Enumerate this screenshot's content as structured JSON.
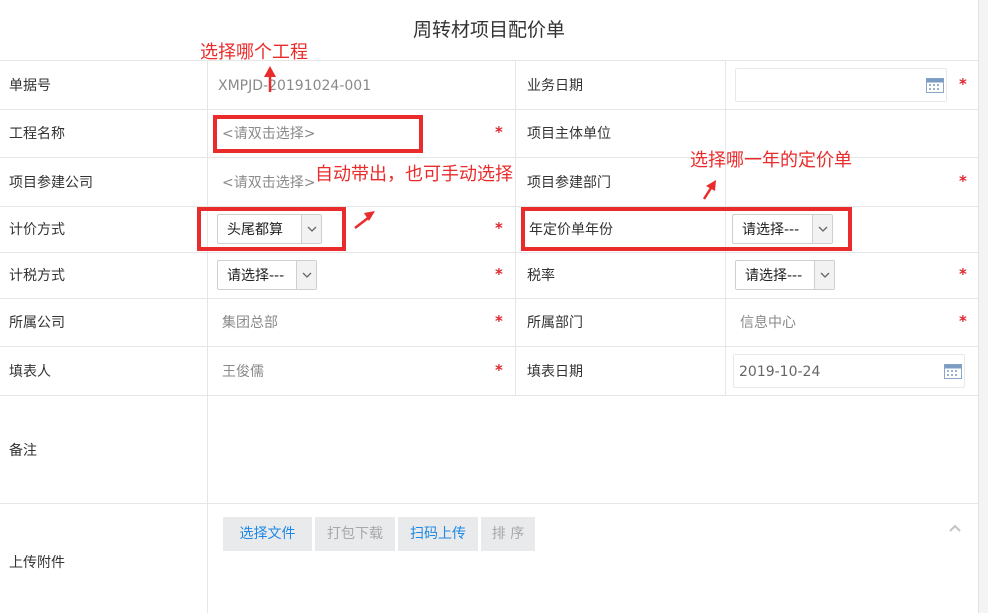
{
  "title": "周转材项目配价单",
  "fields": {
    "bill_no_label": "单据号",
    "bill_no_value": "XMPJD-20191024-001",
    "biz_date_label": "业务日期",
    "project_name_label": "工程名称",
    "project_name_value": "<请双击选择>",
    "project_unit_label": "项目主体单位",
    "project_company_label": "项目参建公司",
    "project_company_value": "<请双击选择>",
    "project_dept_label": "项目参建部门",
    "pricing_method_label": "计价方式",
    "pricing_method_value": "头尾都算",
    "year_label": "年定价单年份",
    "year_value": "请选择---",
    "tax_method_label": "计税方式",
    "tax_method_value": "请选择---",
    "tax_rate_label": "税率",
    "tax_rate_value": "请选择---",
    "company_label": "所属公司",
    "company_value": "集团总部",
    "dept_label": "所属部门",
    "dept_value": "信息中心",
    "filler_label": "填表人",
    "filler_value": "王俊儒",
    "fill_date_label": "填表日期",
    "fill_date_value": "2019-10-24",
    "remark_label": "备注",
    "attachment_label": "上传附件"
  },
  "required_mark": "*",
  "upload_buttons": {
    "select_file": "选择文件",
    "pack_download": "打包下载",
    "scan_upload": "扫码上传",
    "sort": "排 序"
  },
  "annotations": {
    "project_hint": "选择哪个工程",
    "auto_hint": "自动带出，也可手动选择",
    "year_hint": "选择哪一年的定价单"
  },
  "colors": {
    "annotation_red": "#ea2b2b",
    "required_red": "#e0272f",
    "link_blue": "#1e88e5",
    "disabled_gray": "#a8a8a8"
  }
}
